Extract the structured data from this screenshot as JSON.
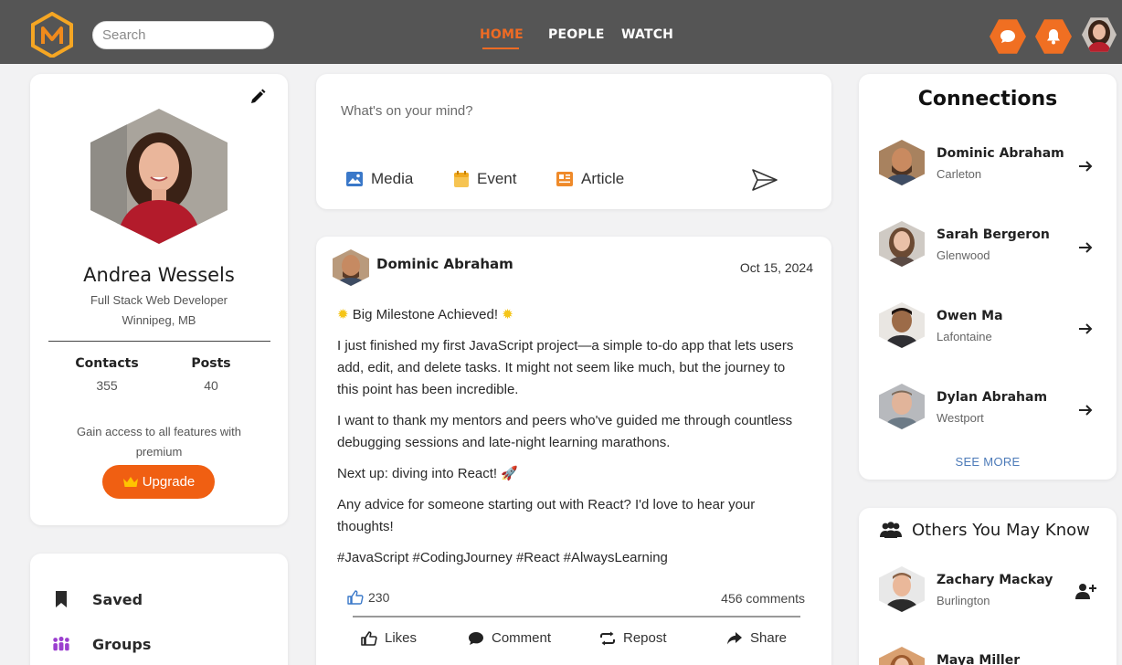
{
  "header": {
    "search_placeholder": "Search",
    "nav": [
      {
        "label": "HOME",
        "active": true
      },
      {
        "label": "PEOPLE",
        "active": false
      },
      {
        "label": "WATCH",
        "active": false
      }
    ],
    "accent_color": "#f06f22",
    "bar_color": "#555555"
  },
  "profile": {
    "name": "Andrea Wessels",
    "title": "Full Stack Web Developer",
    "location": "Winnipeg, MB",
    "contacts_label": "Contacts",
    "contacts_value": "355",
    "posts_label": "Posts",
    "posts_value": "40",
    "premium_text": "Gain access to all features with premium",
    "upgrade_label": "Upgrade"
  },
  "menu": [
    {
      "label": "Saved",
      "icon": "bookmark-icon"
    },
    {
      "label": "Groups",
      "icon": "groups-icon"
    }
  ],
  "composer": {
    "placeholder": "What's on your mind?",
    "actions": [
      {
        "label": "Media",
        "icon": "image-icon"
      },
      {
        "label": "Event",
        "icon": "calendar-icon"
      },
      {
        "label": "Article",
        "icon": "article-icon"
      }
    ]
  },
  "post": {
    "author": "Dominic Abraham",
    "date": "Oct 15, 2024",
    "headline": "Big Milestone Achieved!",
    "paragraphs": [
      "I just finished my first JavaScript project—a simple to-do app that lets users add, edit, and delete tasks. It might not seem like much, but the journey to this point has been incredible.",
      "I want to thank my mentors and peers who've guided me through countless debugging sessions and late-night learning marathons.",
      "Next up: diving into React! 🚀",
      "Any advice for someone starting out with React? I'd love to hear your thoughts!",
      "#JavaScript #CodingJourney #React #AlwaysLearning"
    ],
    "likes": "230",
    "comments": "456 comments",
    "actions": [
      "Likes",
      "Comment",
      "Repost",
      "Share"
    ]
  },
  "connections": {
    "title": "Connections",
    "items": [
      {
        "name": "Dominic Abraham",
        "location": "Carleton"
      },
      {
        "name": "Sarah Bergeron",
        "location": "Glenwood"
      },
      {
        "name": "Owen Ma",
        "location": "Lafontaine"
      },
      {
        "name": "Dylan Abraham",
        "location": "Westport"
      }
    ],
    "see_more": "SEE MORE"
  },
  "others": {
    "title": "Others You May Know",
    "items": [
      {
        "name": "Zachary Mackay",
        "location": "Burlington"
      },
      {
        "name": "Maya Miller",
        "location": ""
      }
    ]
  }
}
